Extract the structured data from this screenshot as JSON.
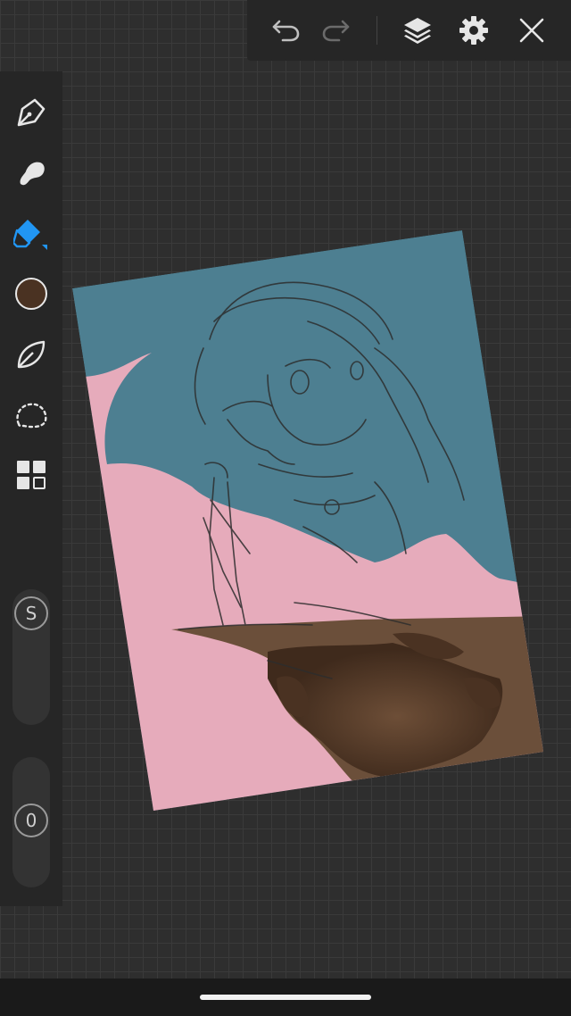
{
  "app": {
    "accent_color": "#2196f3",
    "toolbar_bg": "#262626"
  },
  "toolbar": {
    "buttons": [
      {
        "name": "undo",
        "icon": "undo-icon"
      },
      {
        "name": "redo",
        "icon": "redo-icon",
        "disabled": true
      },
      {
        "name": "layers",
        "icon": "layers-icon"
      },
      {
        "name": "settings",
        "icon": "gear-icon"
      },
      {
        "name": "close",
        "icon": "close-icon"
      }
    ]
  },
  "tools": [
    {
      "name": "pen",
      "icon": "pen-nib-icon",
      "active": false
    },
    {
      "name": "smudge",
      "icon": "smudge-icon",
      "active": false
    },
    {
      "name": "eraser",
      "icon": "eraser-icon",
      "active": true
    },
    {
      "name": "color",
      "icon": "color-swatch",
      "color": "#4a3222"
    },
    {
      "name": "brush-library",
      "icon": "leaf-icon",
      "active": false
    },
    {
      "name": "lasso",
      "icon": "lasso-icon",
      "active": false
    },
    {
      "name": "layers-grid",
      "icon": "grid-icon",
      "active": false
    }
  ],
  "sliders": {
    "size_label": "S",
    "opacity_label": "0"
  },
  "canvas": {
    "colors": {
      "sky": "#4d7f91",
      "cloud": "#e6abbb",
      "cliff": "#6b4f3a",
      "shadow": "#4a3222",
      "sketch": "#2d2d2d"
    }
  }
}
